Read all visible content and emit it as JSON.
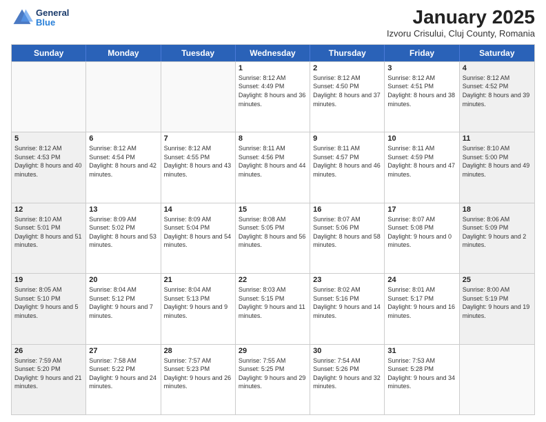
{
  "header": {
    "logo_line1": "General",
    "logo_line2": "Blue",
    "title": "January 2025",
    "subtitle": "Izvoru Crisului, Cluj County, Romania"
  },
  "weekdays": [
    "Sunday",
    "Monday",
    "Tuesday",
    "Wednesday",
    "Thursday",
    "Friday",
    "Saturday"
  ],
  "rows": [
    [
      {
        "date": "",
        "info": "",
        "empty": true
      },
      {
        "date": "",
        "info": "",
        "empty": true
      },
      {
        "date": "",
        "info": "",
        "empty": true
      },
      {
        "date": "1",
        "info": "Sunrise: 8:12 AM\nSunset: 4:49 PM\nDaylight: 8 hours and 36 minutes.",
        "shaded": false
      },
      {
        "date": "2",
        "info": "Sunrise: 8:12 AM\nSunset: 4:50 PM\nDaylight: 8 hours and 37 minutes.",
        "shaded": false
      },
      {
        "date": "3",
        "info": "Sunrise: 8:12 AM\nSunset: 4:51 PM\nDaylight: 8 hours and 38 minutes.",
        "shaded": false
      },
      {
        "date": "4",
        "info": "Sunrise: 8:12 AM\nSunset: 4:52 PM\nDaylight: 8 hours and 39 minutes.",
        "shaded": true
      }
    ],
    [
      {
        "date": "5",
        "info": "Sunrise: 8:12 AM\nSunset: 4:53 PM\nDaylight: 8 hours and 40 minutes.",
        "shaded": true
      },
      {
        "date": "6",
        "info": "Sunrise: 8:12 AM\nSunset: 4:54 PM\nDaylight: 8 hours and 42 minutes.",
        "shaded": false
      },
      {
        "date": "7",
        "info": "Sunrise: 8:12 AM\nSunset: 4:55 PM\nDaylight: 8 hours and 43 minutes.",
        "shaded": false
      },
      {
        "date": "8",
        "info": "Sunrise: 8:11 AM\nSunset: 4:56 PM\nDaylight: 8 hours and 44 minutes.",
        "shaded": false
      },
      {
        "date": "9",
        "info": "Sunrise: 8:11 AM\nSunset: 4:57 PM\nDaylight: 8 hours and 46 minutes.",
        "shaded": false
      },
      {
        "date": "10",
        "info": "Sunrise: 8:11 AM\nSunset: 4:59 PM\nDaylight: 8 hours and 47 minutes.",
        "shaded": false
      },
      {
        "date": "11",
        "info": "Sunrise: 8:10 AM\nSunset: 5:00 PM\nDaylight: 8 hours and 49 minutes.",
        "shaded": true
      }
    ],
    [
      {
        "date": "12",
        "info": "Sunrise: 8:10 AM\nSunset: 5:01 PM\nDaylight: 8 hours and 51 minutes.",
        "shaded": true
      },
      {
        "date": "13",
        "info": "Sunrise: 8:09 AM\nSunset: 5:02 PM\nDaylight: 8 hours and 53 minutes.",
        "shaded": false
      },
      {
        "date": "14",
        "info": "Sunrise: 8:09 AM\nSunset: 5:04 PM\nDaylight: 8 hours and 54 minutes.",
        "shaded": false
      },
      {
        "date": "15",
        "info": "Sunrise: 8:08 AM\nSunset: 5:05 PM\nDaylight: 8 hours and 56 minutes.",
        "shaded": false
      },
      {
        "date": "16",
        "info": "Sunrise: 8:07 AM\nSunset: 5:06 PM\nDaylight: 8 hours and 58 minutes.",
        "shaded": false
      },
      {
        "date": "17",
        "info": "Sunrise: 8:07 AM\nSunset: 5:08 PM\nDaylight: 9 hours and 0 minutes.",
        "shaded": false
      },
      {
        "date": "18",
        "info": "Sunrise: 8:06 AM\nSunset: 5:09 PM\nDaylight: 9 hours and 2 minutes.",
        "shaded": true
      }
    ],
    [
      {
        "date": "19",
        "info": "Sunrise: 8:05 AM\nSunset: 5:10 PM\nDaylight: 9 hours and 5 minutes.",
        "shaded": true
      },
      {
        "date": "20",
        "info": "Sunrise: 8:04 AM\nSunset: 5:12 PM\nDaylight: 9 hours and 7 minutes.",
        "shaded": false
      },
      {
        "date": "21",
        "info": "Sunrise: 8:04 AM\nSunset: 5:13 PM\nDaylight: 9 hours and 9 minutes.",
        "shaded": false
      },
      {
        "date": "22",
        "info": "Sunrise: 8:03 AM\nSunset: 5:15 PM\nDaylight: 9 hours and 11 minutes.",
        "shaded": false
      },
      {
        "date": "23",
        "info": "Sunrise: 8:02 AM\nSunset: 5:16 PM\nDaylight: 9 hours and 14 minutes.",
        "shaded": false
      },
      {
        "date": "24",
        "info": "Sunrise: 8:01 AM\nSunset: 5:17 PM\nDaylight: 9 hours and 16 minutes.",
        "shaded": false
      },
      {
        "date": "25",
        "info": "Sunrise: 8:00 AM\nSunset: 5:19 PM\nDaylight: 9 hours and 19 minutes.",
        "shaded": true
      }
    ],
    [
      {
        "date": "26",
        "info": "Sunrise: 7:59 AM\nSunset: 5:20 PM\nDaylight: 9 hours and 21 minutes.",
        "shaded": true
      },
      {
        "date": "27",
        "info": "Sunrise: 7:58 AM\nSunset: 5:22 PM\nDaylight: 9 hours and 24 minutes.",
        "shaded": false
      },
      {
        "date": "28",
        "info": "Sunrise: 7:57 AM\nSunset: 5:23 PM\nDaylight: 9 hours and 26 minutes.",
        "shaded": false
      },
      {
        "date": "29",
        "info": "Sunrise: 7:55 AM\nSunset: 5:25 PM\nDaylight: 9 hours and 29 minutes.",
        "shaded": false
      },
      {
        "date": "30",
        "info": "Sunrise: 7:54 AM\nSunset: 5:26 PM\nDaylight: 9 hours and 32 minutes.",
        "shaded": false
      },
      {
        "date": "31",
        "info": "Sunrise: 7:53 AM\nSunset: 5:28 PM\nDaylight: 9 hours and 34 minutes.",
        "shaded": false
      },
      {
        "date": "",
        "info": "",
        "empty": true
      }
    ]
  ]
}
